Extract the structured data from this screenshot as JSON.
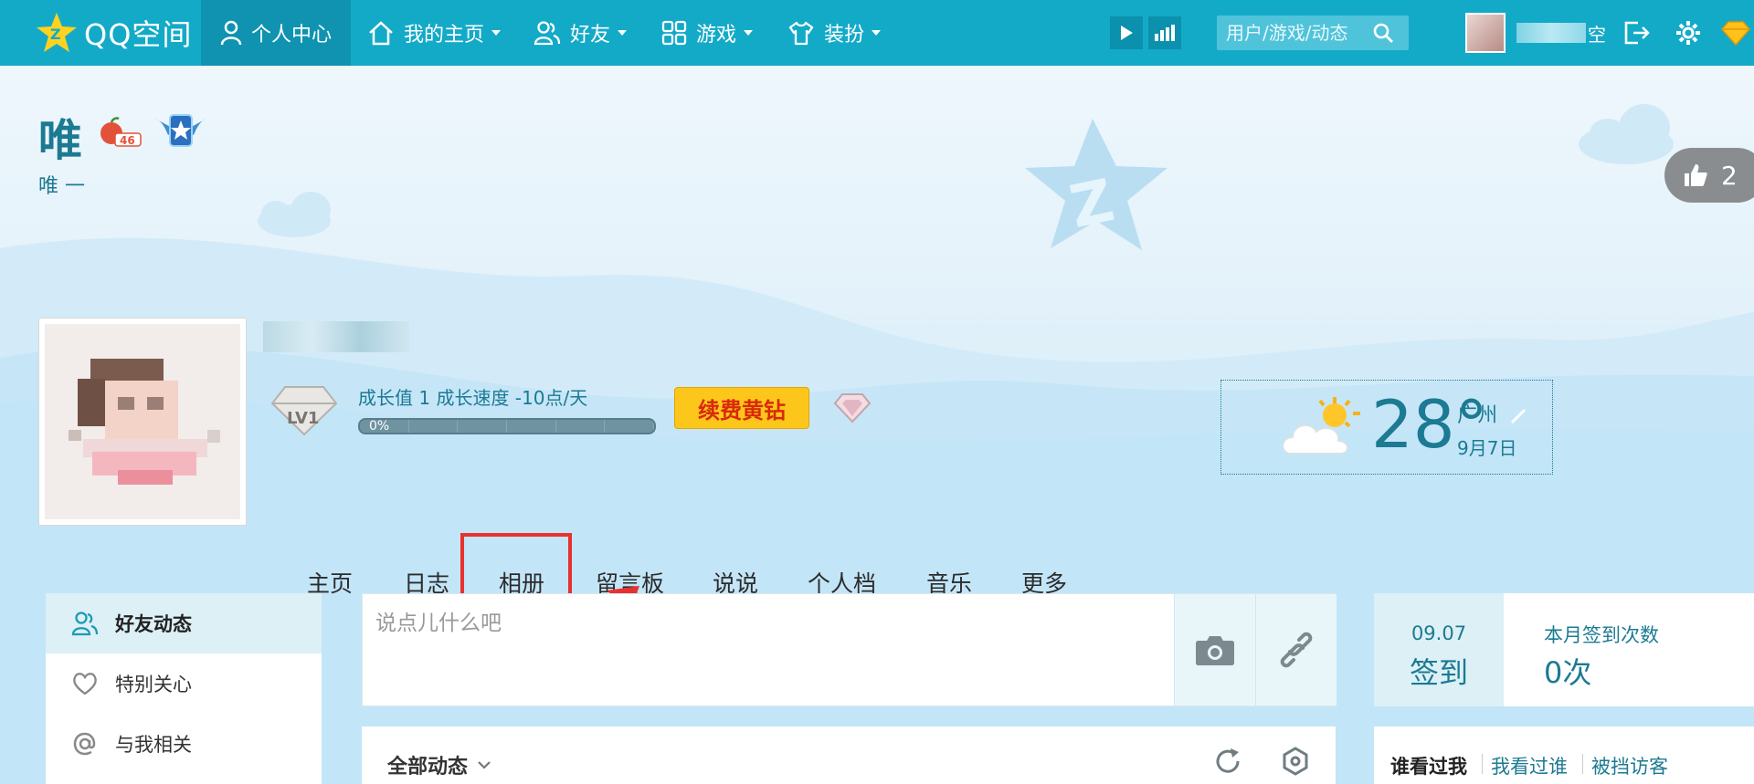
{
  "topbar": {
    "logo_text": "QQ空间",
    "nav": [
      {
        "label": "个人中心",
        "icon": "person-icon",
        "active": true
      },
      {
        "label": "我的主页",
        "icon": "home-icon"
      },
      {
        "label": "好友",
        "icon": "friends-icon"
      },
      {
        "label": "游戏",
        "icon": "grid-icon"
      },
      {
        "label": "装扮",
        "icon": "shirt-icon"
      }
    ],
    "search_placeholder": "用户/游戏/动态",
    "user_name_suffix": "空",
    "colors": {
      "bar": "#13aac8",
      "active": "#0f93b0"
    }
  },
  "banner": {
    "space_title": "唯",
    "space_subtitle": "唯 一",
    "badge_level": "46",
    "like_count": "2",
    "growth": {
      "label": "成长值 1   成长速度 -10点/天",
      "percent_text": "0%",
      "percent": 0,
      "level": "LV1"
    },
    "renew_label": "续费黄钻",
    "weather": {
      "temp": "28°",
      "city": "广州",
      "date": "9月7日"
    }
  },
  "main_tabs": [
    "主页",
    "日志",
    "相册",
    "留言板",
    "说说",
    "个人档",
    "音乐",
    "更多"
  ],
  "highlighted_tab": "相册",
  "left_menu": [
    {
      "label": "好友动态",
      "icon": "friends-feed-icon",
      "active": true
    },
    {
      "label": "特别关心",
      "icon": "heart-icon"
    },
    {
      "label": "与我相关",
      "icon": "at-icon"
    }
  ],
  "post_box": {
    "placeholder": "说点儿什么吧"
  },
  "feed": {
    "filter_label": "全部动态"
  },
  "checkin": {
    "date": "09.07",
    "button": "签到",
    "count_label": "本月签到次数",
    "count": "0次"
  },
  "visitors": {
    "tabs": [
      "谁看过我",
      "我看过谁",
      "被挡访客"
    ]
  }
}
